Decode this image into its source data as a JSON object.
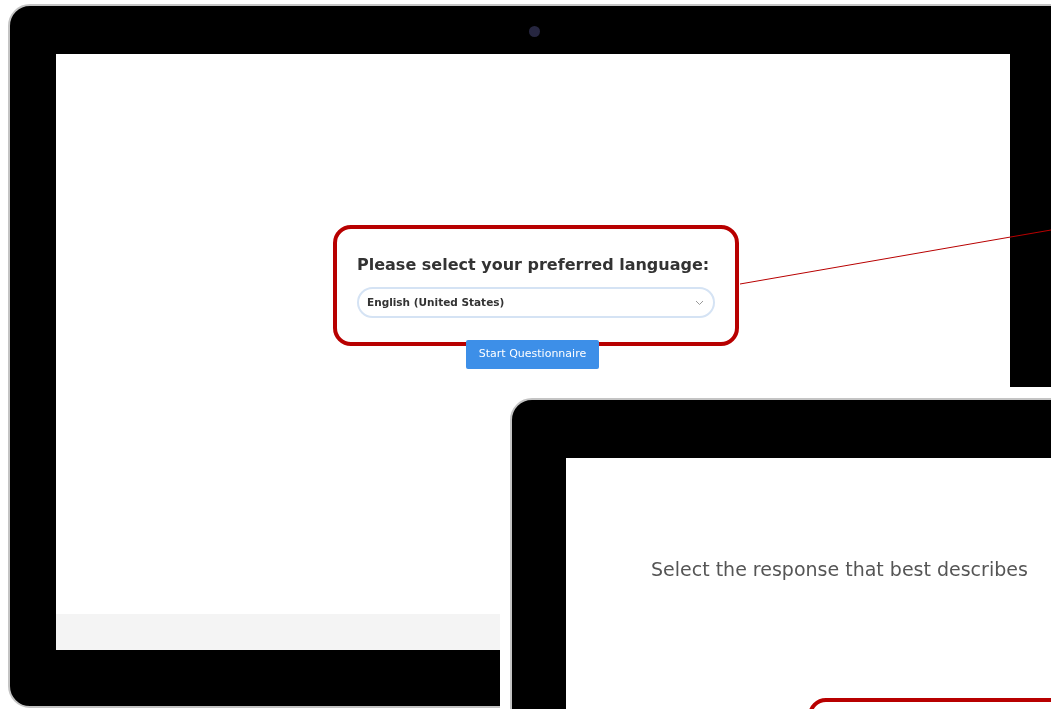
{
  "language_screen": {
    "heading": "Please select your preferred language:",
    "language_select": {
      "value": "English (United States)"
    },
    "start_button": "Start Questionnaire"
  },
  "question_screen": {
    "prompt": "Select the response that best describes"
  }
}
